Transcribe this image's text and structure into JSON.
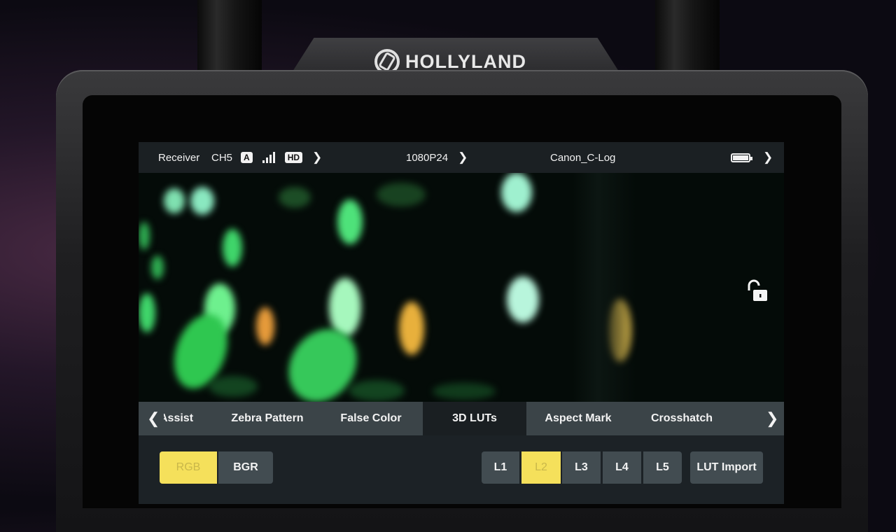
{
  "device": {
    "brand": "HOLLYLAND"
  },
  "status_bar": {
    "mode": "Receiver",
    "channel": "CH5",
    "antenna_badge": "A",
    "signal_bars": 4,
    "quality_badge": "HD",
    "resolution": "1080P24",
    "log_profile": "Canon_C-Log",
    "battery_level": 1.0
  },
  "tabs": {
    "items": [
      "Assist",
      "Zebra Pattern",
      "False Color",
      "3D LUTs",
      "Aspect Mark",
      "Crosshatch"
    ],
    "active": "3D LUTs"
  },
  "color_order": {
    "options": [
      "RGB",
      "BGR"
    ],
    "selected": "RGB"
  },
  "lut_slots": {
    "options": [
      "L1",
      "L2",
      "L3",
      "L4",
      "L5"
    ],
    "selected": "L2",
    "import_label": "LUT Import"
  },
  "colors": {
    "selected_button": "#f5e05b",
    "button": "#424c51",
    "panel": "#1c2226",
    "active_tab": "#1a1f22"
  },
  "icons": {
    "lock": "unlock-icon",
    "signal": "signal-bars-icon",
    "battery": "battery-icon",
    "prev": "chevron-left-icon",
    "next": "chevron-right-icon"
  }
}
